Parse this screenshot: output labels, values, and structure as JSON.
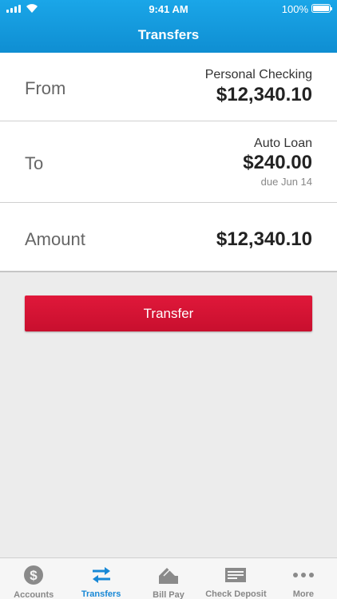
{
  "status_bar": {
    "time": "9:41 AM",
    "battery": "100%"
  },
  "header": {
    "title": "Transfers"
  },
  "from": {
    "label": "From",
    "account": "Personal Checking",
    "amount": "$12,340.10"
  },
  "to": {
    "label": "To",
    "account": "Auto Loan",
    "amount": "$240.00",
    "due": "due Jun 14"
  },
  "amount_row": {
    "label": "Amount",
    "value": "$12,340.10"
  },
  "transfer_button": {
    "label": "Transfer"
  },
  "tabs": [
    {
      "label": "Accounts",
      "icon": "dollar-icon"
    },
    {
      "label": "Transfers",
      "icon": "transfer-arrows-icon",
      "active": true
    },
    {
      "label": "Bill Pay",
      "icon": "bill-pay-icon"
    },
    {
      "label": "Check Deposit",
      "icon": "check-icon"
    },
    {
      "label": "More",
      "icon": "more-icon"
    }
  ],
  "colors": {
    "header": "#1aa6e8",
    "accent": "#1888d6",
    "button": "#d4143a"
  }
}
